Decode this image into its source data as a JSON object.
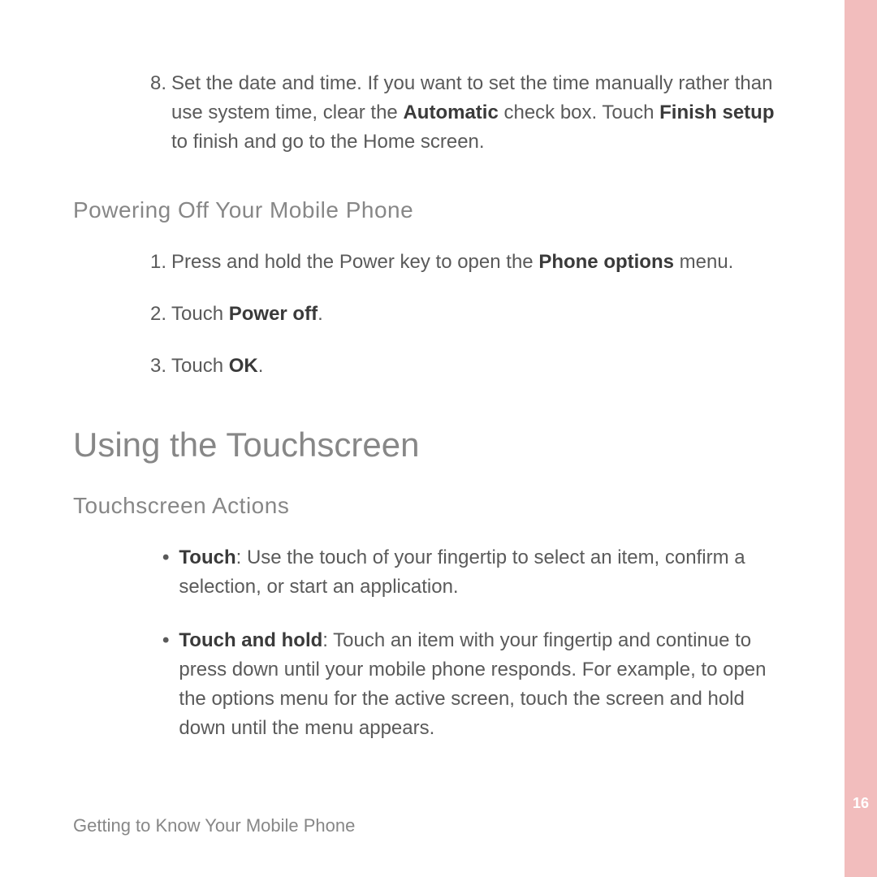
{
  "step8": {
    "number": "8.",
    "text_part1": "Set the date and time. If you want to set the time manually rather than use system time, clear the ",
    "bold1": "Automatic",
    "text_part2": " check box. Touch ",
    "bold2": "Finish setup",
    "text_part3": " to finish and go to the Home screen."
  },
  "powering_off": {
    "heading": "Powering Off Your Mobile Phone",
    "items": [
      {
        "num": "1.",
        "pre": "Press and hold the Power key to open the ",
        "bold": "Phone options",
        "post": " menu."
      },
      {
        "num": "2.",
        "pre": "Touch ",
        "bold": "Power off",
        "post": "."
      },
      {
        "num": "3.",
        "pre": "Touch ",
        "bold": "OK",
        "post": "."
      }
    ]
  },
  "touchscreen": {
    "heading": "Using the Touchscreen",
    "subheading": "Touchscreen Actions",
    "bullets": [
      {
        "bold": "Touch",
        "text": ": Use the touch of your fingertip to select an item, confirm a selection, or start an application."
      },
      {
        "bold": "Touch and hold",
        "text": ": Touch an item with your fingertip and continue to press down until your mobile phone responds. For example, to open the options menu for the active screen, touch the screen and hold down until the menu appears."
      }
    ]
  },
  "footer": "Getting to Know Your Mobile Phone",
  "page_number": "16"
}
